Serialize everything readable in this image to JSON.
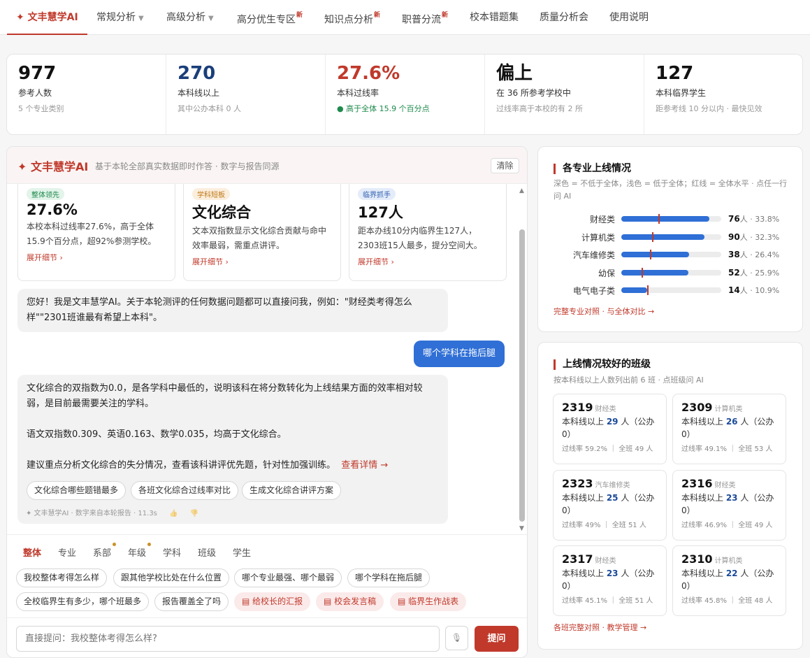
{
  "nav": {
    "items": [
      {
        "label": "✦ 文丰慧学AI",
        "active": true
      },
      {
        "label": "常规分析",
        "caret": "▼"
      },
      {
        "label": "高级分析",
        "caret": "▼"
      },
      {
        "label": "高分优生专区",
        "badge": "新"
      },
      {
        "label": "知识点分析",
        "badge": "新"
      },
      {
        "label": "职普分流",
        "badge": "新"
      },
      {
        "label": "校本错题集"
      },
      {
        "label": "质量分析会"
      },
      {
        "label": "使用说明"
      }
    ]
  },
  "stats": [
    {
      "value": "977",
      "label": "参考人数",
      "sub": "5 个专业类别",
      "color": "#111111"
    },
    {
      "value": "270",
      "label": "本科线以上",
      "sub": "其中公办本科 0 人",
      "color": "#1a3f7a"
    },
    {
      "value": "27.6%",
      "label": "本科过线率",
      "sub": "● 高于全体 15.9 个百分点",
      "color": "#c0392b",
      "sub_color": "#1e8a4c"
    },
    {
      "value": "偏上",
      "label": "在 36 所参考学校中",
      "sub": "过线率高于本校的有 2 所",
      "color": "#111111"
    },
    {
      "value": "127",
      "label": "本科临界学生",
      "sub": "距参考线 10 分以内 · 最快见效",
      "color": "#111111"
    }
  ],
  "chat": {
    "brand": "✦ 文丰慧学AI",
    "brand_sub": "基于本轮全部真实数据即时作答 · 数字与报告同源",
    "clear": "清除",
    "insights": [
      {
        "tag": "整体领先",
        "tag_bg": "#e3f4ea",
        "tag_color": "#1e8a4c",
        "value": "27.6%",
        "text": "本校本科过线率27.6%，高于全体15.9个百分点，超92%参测学校。",
        "link": "展开细节 ›"
      },
      {
        "tag": "学科短板",
        "tag_bg": "#fbeedd",
        "tag_color": "#c07a1a",
        "value": "文化综合",
        "text": "文本双指数显示文化综合贡献与命中效率最弱，需重点讲评。",
        "link": "展开细节 ›"
      },
      {
        "tag": "临界抓手",
        "tag_bg": "#e4ecfa",
        "tag_color": "#2f5fb0",
        "value": "127人",
        "text": "距本办线10分内临界生127人，2303班15人最多，提分空间大。",
        "link": "展开细节 ›"
      }
    ],
    "greeting": "您好！我是文丰慧学AI。关于本轮测评的任何数据问题都可以直接问我，例如：\"财经类考得怎么样\"\"2301班谁最有希望上本科\"。",
    "user_msg": "哪个学科在拖后腿",
    "answer": {
      "p1": "文化综合的双指数为0.0，是各学科中最低的，说明该科在将分数转化为上线结果方面的效率相对较弱，是目前最需要关注的学科。",
      "p2": "语文双指数0.309、英语0.163、数学0.035，均高于文化综合。",
      "p3": "建议重点分析文化综合的失分情况，查看该科讲评优先题，针对性加强训练。",
      "link": "查看详情 →",
      "followups": [
        "文化综合哪些题错最多",
        "各班文化综合过线率对比",
        "生成文化综合讲评方案"
      ],
      "meta": "✦ 文丰慧学AI · 数字来自本轮报告 · 11.3s",
      "thumbs_up": "👍",
      "thumbs_down": "👎"
    },
    "tabs": [
      "整体",
      "专业",
      "系部",
      "年级",
      "学科",
      "班级",
      "学生"
    ],
    "quick": [
      "我校整体考得怎么样",
      "跟其他学校比处在什么位置",
      "哪个专业最强、哪个最弱",
      "哪个学科在拖后腿",
      "全校临界生有多少，哪个班最多",
      "报告覆盖全了吗"
    ],
    "quick_red": [
      "▤ 给校长的汇报",
      "▤ 校会发言稿",
      "▤ 临界生作战表"
    ],
    "input_placeholder": "直接提问：我校整体考得怎么样?",
    "mic": "🎙",
    "send": "提问"
  },
  "majors": {
    "title": "各专业上线情况",
    "sub": "深色 = 不低于全体，浅色 = 低于全体；红线 = 全体水平 · 点任一行问 AI",
    "link": "完整专业对照 · 与全体对比 →",
    "rows": [
      {
        "name": "财经类",
        "count": "76",
        "unit": "人 · ",
        "rate": "33.8%",
        "fill": 0.88,
        "mark": 0.37
      },
      {
        "name": "计算机类",
        "count": "90",
        "unit": "人 · ",
        "rate": "32.3%",
        "fill": 0.83,
        "mark": 0.31
      },
      {
        "name": "汽车维修类",
        "count": "38",
        "unit": "人 · ",
        "rate": "26.4%",
        "fill": 0.68,
        "mark": 0.29
      },
      {
        "name": "幼保",
        "count": "52",
        "unit": "人 · ",
        "rate": "25.9%",
        "fill": 0.67,
        "mark": 0.2
      },
      {
        "name": "电气电子类",
        "count": "14",
        "unit": "人 · ",
        "rate": "10.9%",
        "fill": 0.26,
        "mark": 0.26
      }
    ]
  },
  "classes": {
    "title": "上线情况较好的班级",
    "sub": "按本科线以上人数列出前 6 班 · 点班级问 AI",
    "link": "各班完整对照 · 教学管理 →",
    "line_pre": "本科线以上 ",
    "line_post": " 人（公办 0）",
    "items": [
      {
        "id": "2319",
        "major": "财经类",
        "count": "29",
        "rate": "过线率 59.2% ｜ 全班 49 人"
      },
      {
        "id": "2309",
        "major": "计算机类",
        "count": "26",
        "rate": "过线率 49.1% ｜ 全班 53 人"
      },
      {
        "id": "2323",
        "major": "汽车维修类",
        "count": "25",
        "rate": "过线率 49% ｜ 全班 51 人"
      },
      {
        "id": "2316",
        "major": "财经类",
        "count": "23",
        "rate": "过线率 46.9% ｜ 全班 49 人"
      },
      {
        "id": "2317",
        "major": "财经类",
        "count": "23",
        "rate": "过线率 45.1% ｜ 全班 51 人"
      },
      {
        "id": "2310",
        "major": "计算机类",
        "count": "22",
        "rate": "过线率 45.8% ｜ 全班 48 人"
      }
    ]
  }
}
